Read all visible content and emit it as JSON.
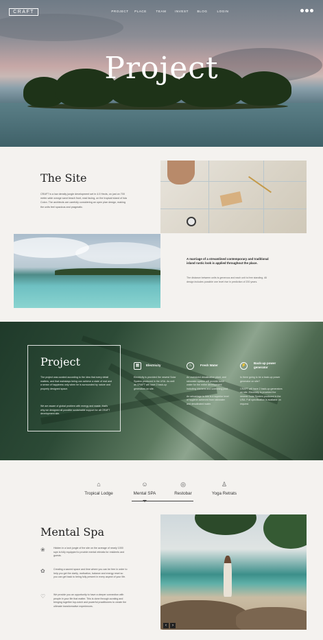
{
  "header": {
    "logo": "CRAFT",
    "nav": [
      "PROJECT",
      "PLACE",
      "TEAM",
      "INVEST",
      "BLOG",
      "LOGIN"
    ],
    "social_icons": [
      "facebook-icon",
      "instagram-icon",
      "twitter-icon"
    ]
  },
  "hero": {
    "title": "Project"
  },
  "site": {
    "title": "The Site",
    "text": "CRAFT is a low density jungle development set in 4.0 Hects, on just on 700 meter-wide orange sand beach front, east facing, on the tropical island of Isla Colon. The architects are carefully considering an open plan design, making the units feel spacious and pragmatic.",
    "quote": "A marriage of a streamlined contemporary and traditional island rustic look is applied throughout the place.",
    "quote_sub": "The distance between units is generous and each unit is free standing. All design includes possible one level rise in prediction of 200 years."
  },
  "project": {
    "title": "Project",
    "text1": "The project was curated according to the idea that every detail matters, and that mainstays being can achieve a state of real and a sense of happiness only when he is surrounded by nature and properly designed space.",
    "text2": "We are aware of global problem with energy and waste, that's why we designed all possible sustainable support for all CRAFT development site.",
    "features": [
      {
        "title": "Electricity",
        "icon": "solar-panel-icon",
        "text": "Electricity is provided the newest Solar System produced in the USA. As well as CRAFT will have 2 back-up generators on site."
      },
      {
        "title": "Fresh Water",
        "icon": "water-drop-icon",
        "text": "An oversized desalination plant, and rainwater system will provide fresh water for the entire development including kitchens and swimming pool.\n\nAn advantage to this is a superior level of hygiene achieved from rainwater and desalinated water."
      },
      {
        "title": "Back-up power generator",
        "icon": "power-icon",
        "text": "Is there going to be a back-up power generator on site?\n\nCRAFT will have 2 back-up generators on site. Electricity is provided the newest Solar System produced in the USA. Full specification is available on request."
      }
    ]
  },
  "tabs": [
    {
      "label": "Tropical Lodge",
      "icon": "lodge-icon"
    },
    {
      "label": "Mental SPA",
      "icon": "spa-head-icon"
    },
    {
      "label": "Restobar",
      "icon": "restobar-icon"
    },
    {
      "label": "Yoga Retrats",
      "icon": "yoga-icon"
    }
  ],
  "spa": {
    "title": "Mental Spa",
    "items": [
      {
        "icon": "leaf-icon",
        "text": "Hidden in a lush jungle of the site on the acreage of nearly 1000 sqm is fully equipped to provide mental retreats for residents and guests."
      },
      {
        "icon": "lotus-icon",
        "text": "Creating a sacred space and time where you can be free in order to help you get the clarity, motivation, balance and energy reset so you can get back to being fully present in every aspect of your life."
      },
      {
        "icon": "heart-icon",
        "text": "We provide you an opportunity to have a deeper connection with people in your life that matter. This is done through curating and bringing together top-notch and powerful practitioners to create the ultimate transformative experiences."
      }
    ],
    "prev": "‹",
    "next": "›"
  }
}
